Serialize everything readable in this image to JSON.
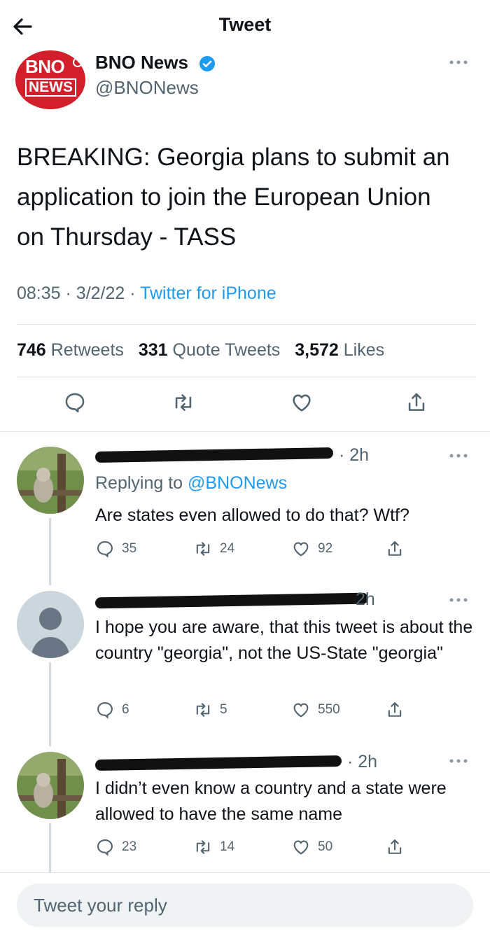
{
  "header": {
    "title": "Tweet"
  },
  "tweet": {
    "author_name": "BNO News",
    "author_handle": "@BNONews",
    "logo_line1": "BNO",
    "logo_line2": "NEWS",
    "text": "BREAKING: Georgia plans to submit an application to join the European Union on Thursday - TASS",
    "time": "08:35",
    "date": "3/2/22",
    "source": "Twitter for iPhone",
    "retweets": "746",
    "retweets_label": "Retweets",
    "quotes": "331",
    "quotes_label": "Quote Tweets",
    "likes": "3,572",
    "likes_label": "Likes"
  },
  "replies": [
    {
      "time": "2h",
      "replying_to_label": "Replying to",
      "replying_to_handle": "@BNONews",
      "text": "Are states even allowed to do that? Wtf?",
      "replies": "35",
      "retweets": "24",
      "likes": "92"
    },
    {
      "time": "2h",
      "text": "I hope you are aware, that this tweet is about the country \"georgia\", not the US-State \"georgia\"",
      "replies": "6",
      "retweets": "5",
      "likes": "550"
    },
    {
      "time": "2h",
      "text": "I didn’t even know a country and a state were allowed to have the same name",
      "replies": "23",
      "retweets": "14",
      "likes": "50"
    }
  ],
  "composer": {
    "placeholder": "Tweet your reply"
  },
  "colors": {
    "accent": "#1d9bf0",
    "secondary_text": "#536471",
    "brand_red": "#d31e2b"
  },
  "icons": [
    "back-arrow-icon",
    "verified-badge-icon",
    "more-icon",
    "reply-icon",
    "retweet-icon",
    "like-icon",
    "share-icon",
    "avatar-placeholder-icon"
  ]
}
